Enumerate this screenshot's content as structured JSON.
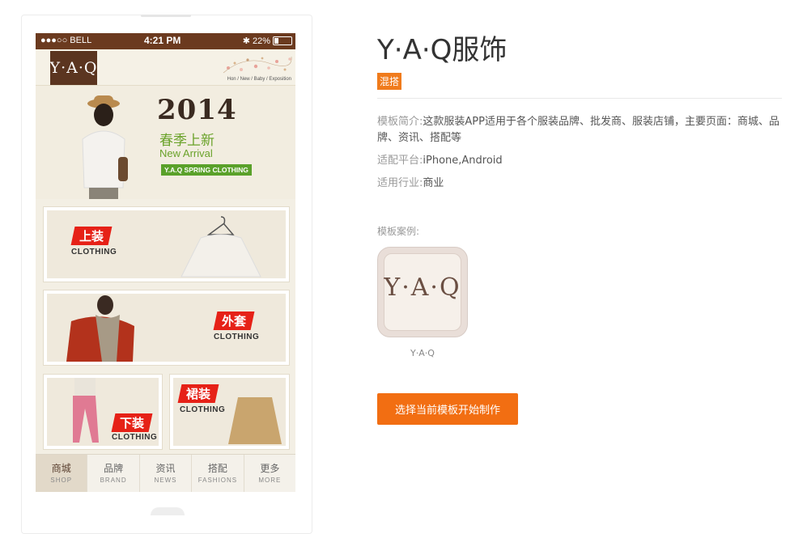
{
  "phone": {
    "status_carrier": "●●●○○ BELL",
    "status_time": "4:21 PM",
    "status_battery": "22%",
    "logo": "Y·A·Q",
    "nav_links": "Hon / New / Baby / Exposition",
    "banner": {
      "year": "2014",
      "cn_title": "春季上新",
      "en_title": "New Arrival",
      "tag": "Y.A.Q SPRING CLOTHING"
    },
    "tiles": [
      {
        "tag": "上装",
        "sub": "CLOTHING"
      },
      {
        "tag": "外套",
        "sub": "CLOTHING"
      },
      {
        "tag": "下装",
        "sub": "CLOTHING"
      },
      {
        "tag": "裙装",
        "sub": "CLOTHING"
      }
    ],
    "tabs": [
      {
        "cn": "商城",
        "en": "SHOP"
      },
      {
        "cn": "品牌",
        "en": "BRAND"
      },
      {
        "cn": "资讯",
        "en": "NEWS"
      },
      {
        "cn": "搭配",
        "en": "FASHIONS"
      },
      {
        "cn": "更多",
        "en": "MORE"
      }
    ]
  },
  "detail": {
    "title": "Y·A·Q服饰",
    "badge": "混搭",
    "intro_label": "模板简介:",
    "intro_value": "这款服装APP适用于各个服装品牌、批发商、服装店铺，主要页面：商城、品牌、资讯、搭配等",
    "platform_label": "适配平台:",
    "platform_value": "iPhone,Android",
    "industry_label": "适用行业:",
    "industry_value": "商业",
    "case_label": "模板案例:",
    "app_icon_text": "Y·A·Q",
    "app_name": "Y·A·Q",
    "cta": "选择当前模板开始制作"
  },
  "colors": {
    "status_bar": "#6b3a1f",
    "accent_orange": "#f26e12",
    "badge_orange": "#f07b1c",
    "tag_red": "#e62117",
    "spring_green": "#5aa12a"
  }
}
